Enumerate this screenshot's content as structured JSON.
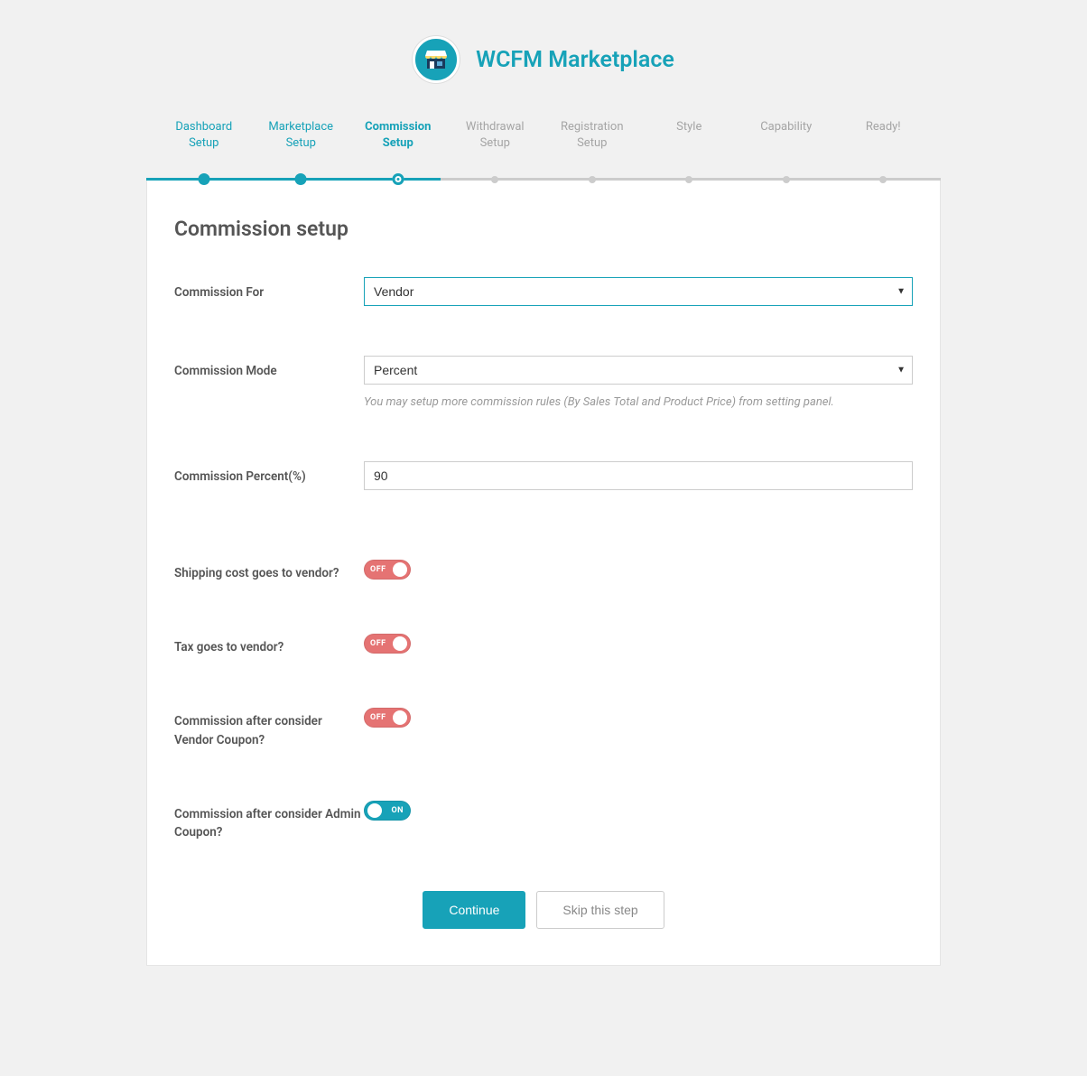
{
  "header": {
    "title": "WCFM Marketplace"
  },
  "steps": [
    {
      "label_line1": "Dashboard",
      "label_line2": "Setup",
      "state": "done"
    },
    {
      "label_line1": "Marketplace",
      "label_line2": "Setup",
      "state": "done"
    },
    {
      "label_line1": "Commission",
      "label_line2": "Setup",
      "state": "current"
    },
    {
      "label_line1": "Withdrawal",
      "label_line2": "Setup",
      "state": "pending"
    },
    {
      "label_line1": "Registration",
      "label_line2": "Setup",
      "state": "pending"
    },
    {
      "label_line1": "Style",
      "label_line2": "",
      "state": "pending"
    },
    {
      "label_line1": "Capability",
      "label_line2": "",
      "state": "pending"
    },
    {
      "label_line1": "Ready!",
      "label_line2": "",
      "state": "pending"
    }
  ],
  "panel": {
    "title": "Commission setup"
  },
  "fields": {
    "commission_for": {
      "label": "Commission For",
      "value": "Vendor"
    },
    "commission_mode": {
      "label": "Commission Mode",
      "value": "Percent",
      "hint": "You may setup more commission rules (By Sales Total and Product Price) from setting panel."
    },
    "commission_percent": {
      "label": "Commission Percent(%)",
      "value": "90"
    },
    "shipping_vendor": {
      "label": "Shipping cost goes to vendor?",
      "state": "off",
      "text": "OFF"
    },
    "tax_vendor": {
      "label": "Tax goes to vendor?",
      "state": "off",
      "text": "OFF"
    },
    "vendor_coupon": {
      "label": "Commission after consider Vendor Coupon?",
      "state": "off",
      "text": "OFF"
    },
    "admin_coupon": {
      "label": "Commission after consider Admin Coupon?",
      "state": "on",
      "text": "ON"
    }
  },
  "actions": {
    "continue": "Continue",
    "skip": "Skip this step"
  }
}
